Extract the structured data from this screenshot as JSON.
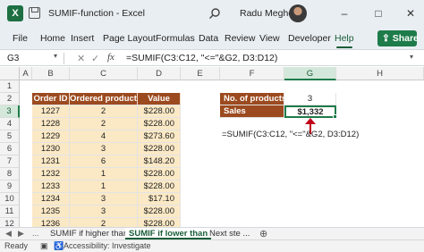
{
  "titlebar": {
    "app_logo": "X",
    "title": "SUMIF-function  -  Excel",
    "user_name": "Radu Meghes",
    "minimize": "–",
    "restore": "□",
    "close": "✕"
  },
  "ribbon": {
    "tabs": [
      "File",
      "Home",
      "Insert",
      "Page Layout",
      "Formulas",
      "Data",
      "Review",
      "View",
      "Developer",
      "Help"
    ],
    "active_tab": "Help",
    "share_label": "Share"
  },
  "formula_bar": {
    "name_box": "G3",
    "cancel": "✕",
    "enter": "✓",
    "fx": "fx",
    "formula": "=SUMIF(C3:C12, \"<=\"&G2, D3:D12)"
  },
  "grid": {
    "columns": [
      "A",
      "B",
      "C",
      "D",
      "E",
      "F",
      "G",
      "H"
    ],
    "selected_column": "G",
    "rows": [
      "1",
      "2",
      "3",
      "4",
      "5",
      "6",
      "7",
      "8",
      "9",
      "10",
      "11",
      "12"
    ],
    "selected_row": "3"
  },
  "table": {
    "headers": [
      "Order ID",
      "Ordered products",
      "Value"
    ],
    "rows": [
      [
        "1227",
        "2",
        "$228.00"
      ],
      [
        "1228",
        "2",
        "$228.00"
      ],
      [
        "1229",
        "4",
        "$273.60"
      ],
      [
        "1230",
        "3",
        "$228.00"
      ],
      [
        "1231",
        "6",
        "$148.20"
      ],
      [
        "1232",
        "1",
        "$228.00"
      ],
      [
        "1233",
        "1",
        "$228.00"
      ],
      [
        "1234",
        "3",
        "$17.10"
      ],
      [
        "1235",
        "3",
        "$228.00"
      ],
      [
        "1236",
        "2",
        "$228.00"
      ]
    ]
  },
  "criteria": {
    "no_products_label": "No. of products",
    "no_products_value": "3",
    "sales_label": "Sales",
    "sales_value": "$1,332",
    "formula_note": "=SUMIF(C3:C12, \"<=\"&G2, D3:D12)"
  },
  "sheet_tabs": {
    "nav_prev": "◀",
    "nav_next": "▶",
    "ellipsis_left": "...",
    "tabs": [
      "SUMIF if higher than",
      "SUMIF if lower than",
      "Next ste ..."
    ],
    "active_tab": "SUMIF if lower than",
    "add": "⊕"
  },
  "status_bar": {
    "ready": "Ready",
    "accessibility": "Accessibility: Investigate"
  },
  "colors": {
    "header_brown": "#9c4a1f",
    "data_fill": "#fbe9c6",
    "excel_green": "#1e7b4a",
    "arrow_red": "#c0001a"
  }
}
